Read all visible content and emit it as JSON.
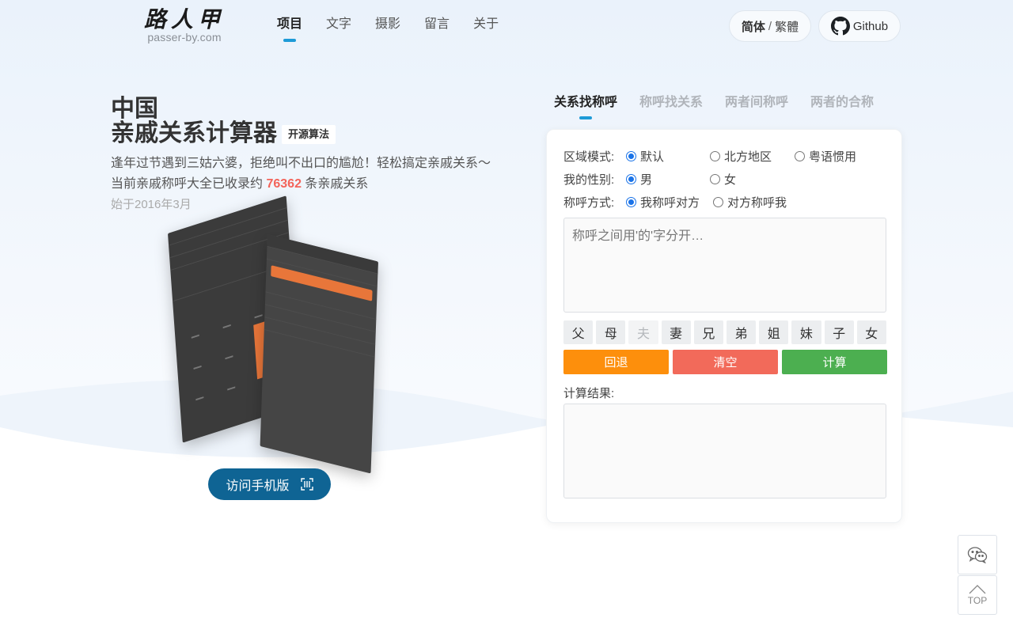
{
  "site": {
    "logo_text": "路人甲",
    "logo_sub": "passer-by.com"
  },
  "nav": {
    "items": [
      {
        "label": "项目",
        "active": true
      },
      {
        "label": "文字"
      },
      {
        "label": "摄影"
      },
      {
        "label": "留言"
      },
      {
        "label": "关于"
      }
    ]
  },
  "header": {
    "lang_current": "简体",
    "lang_sep": "/",
    "lang_alt": "繁體",
    "github_label": "Github"
  },
  "hero": {
    "title_line1": "中国",
    "title_line2": "亲戚关系计算器",
    "badge": "开源算法",
    "desc_line1": "逢年过节遇到三姑六婆，拒绝叫不出口的尴尬！轻松搞定亲戚关系～",
    "desc_line2_prefix": "当前亲戚称呼大全已收录约",
    "desc_count": "76362",
    "desc_line2_suffix": "条亲戚关系",
    "since": "始于2016年3月",
    "mobile_button": "访问手机版"
  },
  "tabs": [
    {
      "label": "关系找称呼",
      "active": true
    },
    {
      "label": "称呼找关系"
    },
    {
      "label": "两者间称呼"
    },
    {
      "label": "两者的合称"
    }
  ],
  "form": {
    "region": {
      "label": "区域模式:",
      "options": [
        "默认",
        "北方地区",
        "粤语惯用"
      ],
      "selected": 0
    },
    "gender": {
      "label": "我的性别:",
      "options": [
        "男",
        "女"
      ],
      "selected": 0
    },
    "mode": {
      "label": "称呼方式:",
      "options": [
        "我称呼对方",
        "对方称呼我"
      ],
      "selected": 0
    },
    "input_placeholder": "称呼之间用'的'字分开…",
    "keys": [
      {
        "label": "父"
      },
      {
        "label": "母"
      },
      {
        "label": "夫",
        "disabled": true
      },
      {
        "label": "妻"
      },
      {
        "label": "兄"
      },
      {
        "label": "弟"
      },
      {
        "label": "姐"
      },
      {
        "label": "妹"
      },
      {
        "label": "子"
      },
      {
        "label": "女"
      }
    ],
    "actions": {
      "back": "回退",
      "clear": "清空",
      "calc": "计算"
    },
    "result_label": "计算结果:"
  },
  "floating": {
    "top_label": "TOP"
  },
  "colors": {
    "accent": "#1e9bd7",
    "highlight": "#f3645a",
    "back_button": "#fd8f0c",
    "clear_button": "#f26a5a",
    "calc_button": "#4caf50",
    "mobile_button": "#0f6494"
  },
  "icons": {
    "github": "github-icon",
    "scan": "scan-icon",
    "wechat": "wechat-icon",
    "top": "arrow-up-icon"
  }
}
